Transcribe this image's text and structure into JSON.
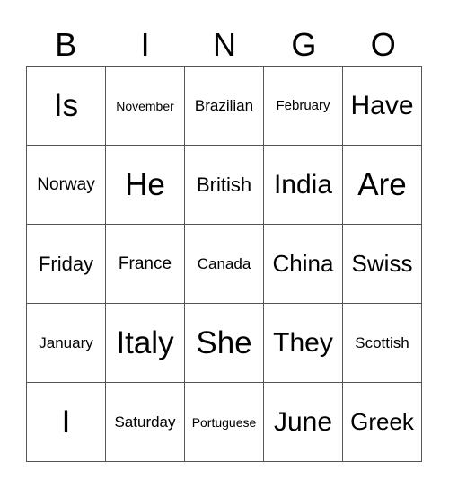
{
  "header": [
    "B",
    "I",
    "N",
    "G",
    "O"
  ],
  "cells": [
    [
      "Is",
      "November",
      "Brazilian",
      "February",
      "Have"
    ],
    [
      "Norway",
      "He",
      "British",
      "India",
      "Are"
    ],
    [
      "Friday",
      "France",
      "Canada",
      "China",
      "Swiss"
    ],
    [
      "January",
      "Italy",
      "She",
      "They",
      "Scottish"
    ],
    [
      "I",
      "Saturday",
      "Portuguese",
      "June",
      "Greek"
    ]
  ]
}
